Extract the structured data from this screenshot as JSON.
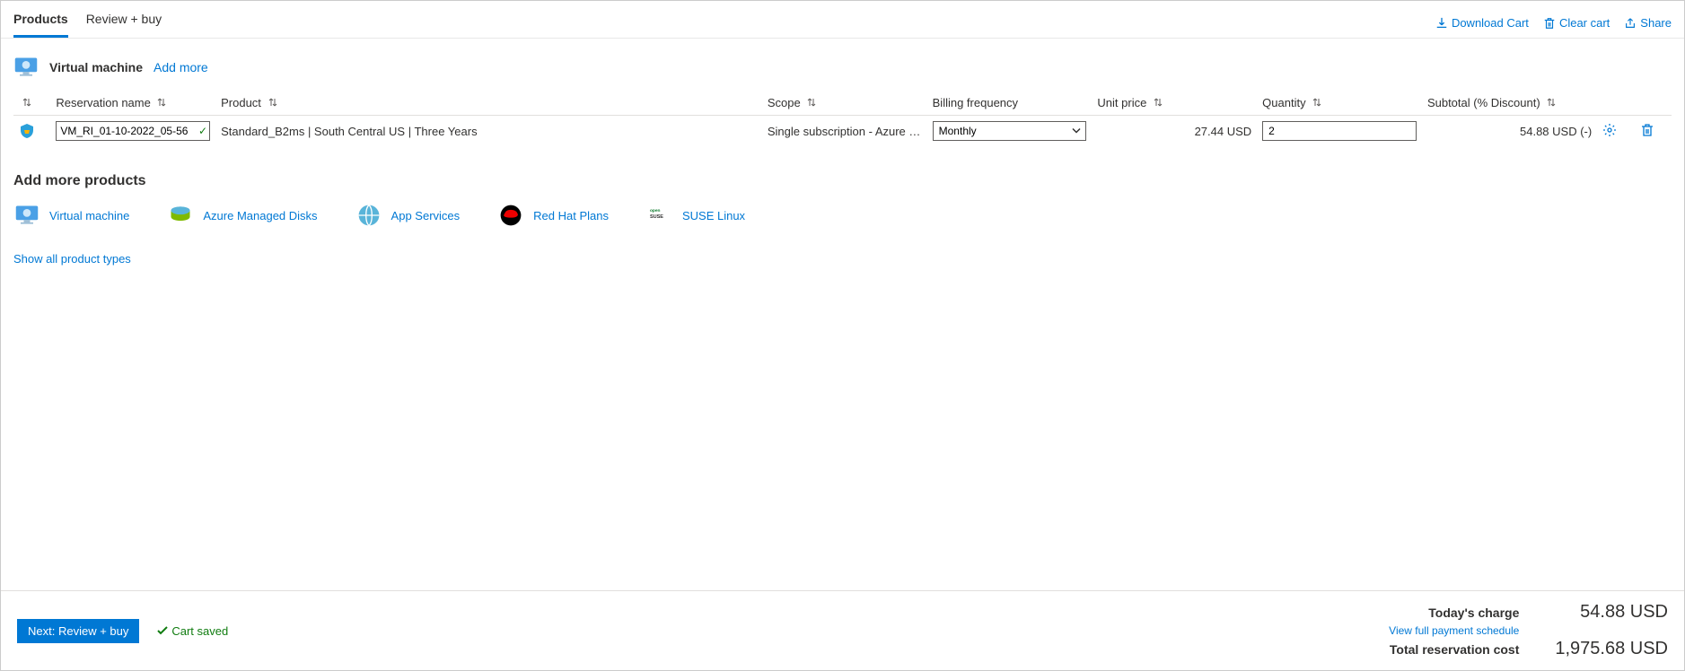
{
  "tabs": {
    "products": "Products",
    "review": "Review + buy"
  },
  "top_actions": {
    "download": "Download Cart",
    "clear": "Clear cart",
    "share": "Share"
  },
  "section": {
    "title": "Virtual machine",
    "add_more": "Add more"
  },
  "columns": {
    "name": "Reservation name",
    "product": "Product",
    "scope": "Scope",
    "freq": "Billing frequency",
    "unit": "Unit price",
    "qty": "Quantity",
    "subtotal": "Subtotal (% Discount)"
  },
  "row": {
    "name": "VM_RI_01-10-2022_05-56",
    "product": "Standard_B2ms | South Central US | Three Years",
    "scope": "Single subscription - Azure P...",
    "freq": "Monthly",
    "unit": "27.44 USD",
    "qty": "2",
    "subtotal": "54.88 USD (-)"
  },
  "add_more_section": {
    "title": "Add more products",
    "items": {
      "vm": "Virtual machine",
      "disks": "Azure Managed Disks",
      "apps": "App Services",
      "rh": "Red Hat Plans",
      "suse": "SUSE Linux"
    },
    "show_all": "Show all product types"
  },
  "footer": {
    "next": "Next: Review + buy",
    "saved": "Cart saved",
    "today_label": "Today's charge",
    "today_value": "54.88 USD",
    "schedule": "View full payment schedule",
    "total_label": "Total reservation cost",
    "total_value": "1,975.68 USD"
  }
}
